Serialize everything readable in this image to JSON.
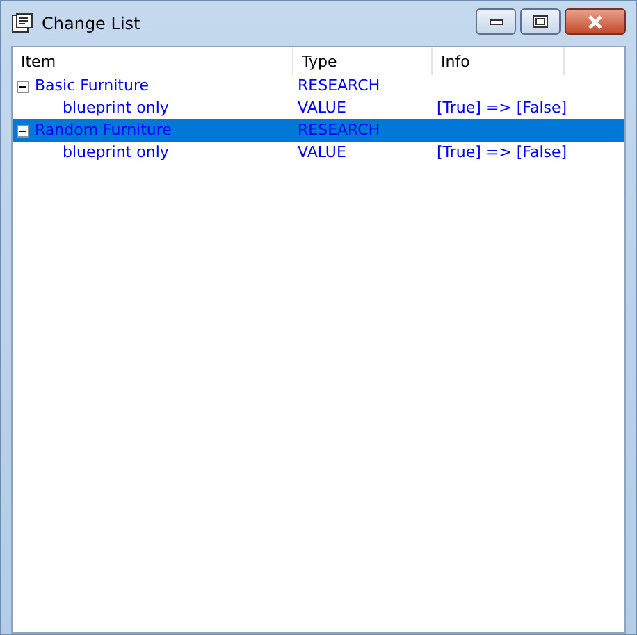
{
  "window": {
    "title": "Change List"
  },
  "columns": [
    "Item",
    "Type",
    "Info"
  ],
  "rows": [
    {
      "item": "Basic Furniture",
      "type": "RESEARCH",
      "expanded": true,
      "selected": false,
      "children": [
        {
          "item": "blueprint only",
          "type": "VALUE",
          "info": "[True] => [False]",
          "selected": false
        }
      ]
    },
    {
      "item": "Random Furniture",
      "type": "RESEARCH",
      "expanded": true,
      "selected": true,
      "children": [
        {
          "item": "blueprint only",
          "type": "VALUE",
          "info": "[True] => [False]",
          "selected": false
        }
      ]
    }
  ]
}
